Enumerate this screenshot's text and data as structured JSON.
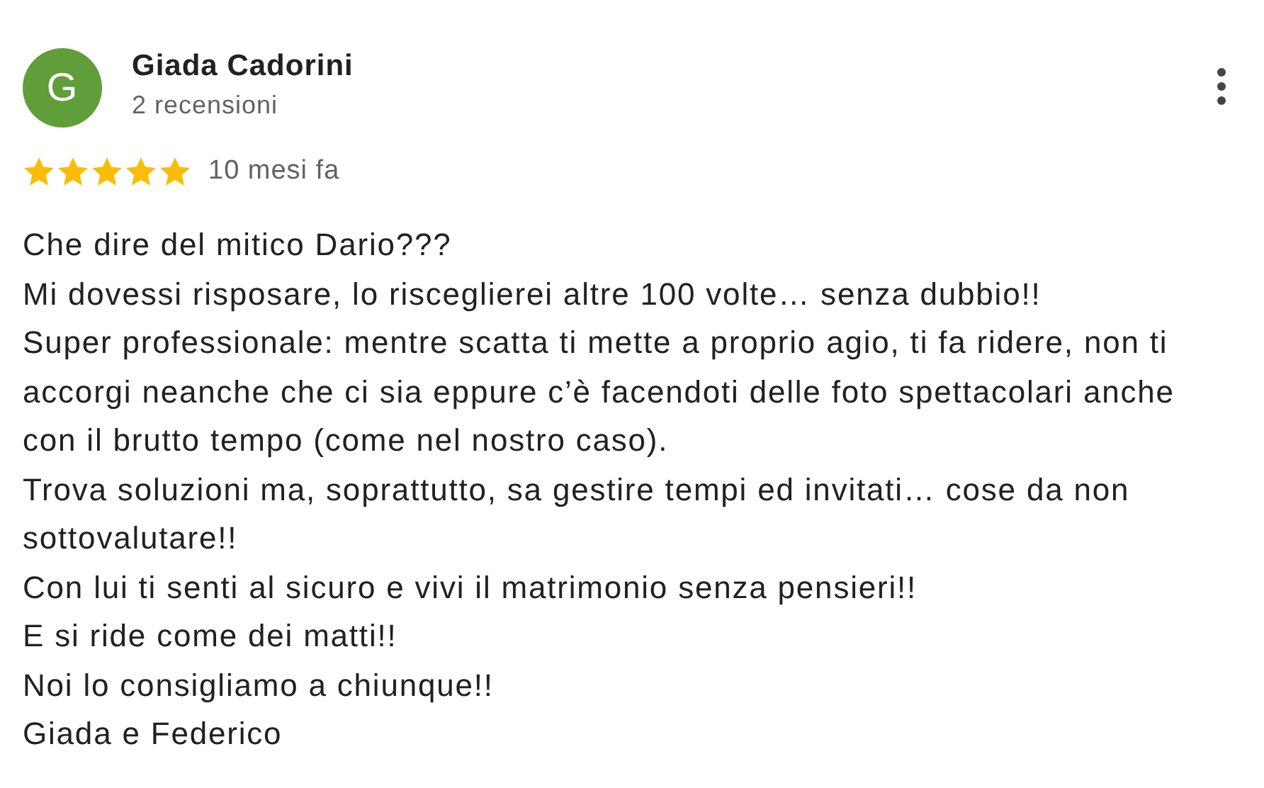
{
  "review": {
    "avatar_letter": "G",
    "author": "Giada Cadorini",
    "reviews_count": "2 recensioni",
    "stars": 5,
    "time": "10 mesi fa",
    "lines": [
      "Che dire del mitico Dario???",
      "Mi dovessi risposare, lo risceglierei altre 100 volte… senza dubbio!!",
      "Super professionale: mentre scatta ti mette a proprio agio, ti fa ridere, non ti accorgi neanche che ci sia eppure c’è facendoti delle foto spettacolari anche con il brutto tempo (come nel nostro caso).",
      "Trova soluzioni ma, soprattutto, sa gestire tempi ed invitati… cose da non sottovalutare!!",
      "Con lui ti senti al sicuro e vivi il matrimonio senza pensieri!!",
      "E si ride come dei matti!!",
      "Noi lo consigliamo a chiunque!!",
      "Giada e Federico"
    ]
  }
}
